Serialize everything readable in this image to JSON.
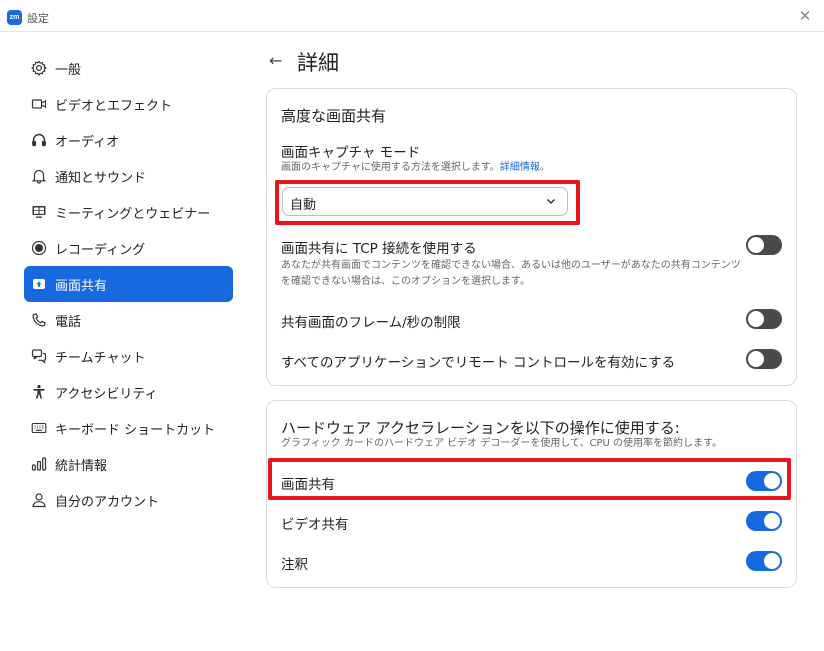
{
  "window": {
    "logo": "zm",
    "title": "設定",
    "close": "✕"
  },
  "sidebar": {
    "items": [
      {
        "label": "一般",
        "icon": "gear-icon"
      },
      {
        "label": "ビデオとエフェクト",
        "icon": "video-camera-icon"
      },
      {
        "label": "オーディオ",
        "icon": "headphones-icon"
      },
      {
        "label": "通知とサウンド",
        "icon": "bell-icon"
      },
      {
        "label": "ミーティングとウェビナー",
        "icon": "meeting-icon"
      },
      {
        "label": "レコーディング",
        "icon": "record-icon"
      },
      {
        "label": "画面共有",
        "icon": "share-screen-icon",
        "active": true
      },
      {
        "label": "電話",
        "icon": "phone-icon"
      },
      {
        "label": "チームチャット",
        "icon": "chat-icon"
      },
      {
        "label": "アクセシビリティ",
        "icon": "accessibility-icon"
      },
      {
        "label": "キーボード ショートカット",
        "icon": "keyboard-icon"
      },
      {
        "label": "統計情報",
        "icon": "stats-icon"
      },
      {
        "label": "自分のアカウント",
        "icon": "user-icon"
      }
    ]
  },
  "header": {
    "back": "←",
    "title": "詳細"
  },
  "advanced_sharing": {
    "title": "高度な画面共有",
    "capture_mode": {
      "label": "画面キャプチャ モード",
      "desc": "画面のキャプチャに使用する方法を選択します。",
      "link": "詳細情報",
      "desc_end": "。",
      "selected": "自動"
    },
    "tcp": {
      "label": "画面共有に TCP 接続を使用する",
      "desc": "あなたが共有画面でコンテンツを確認できない場合、あるいは他のユーザーがあなたの共有コンテンツを確認できない場合は、このオプションを選択します。",
      "on": false
    },
    "fps_limit": {
      "label": "共有画面のフレーム/秒の制限",
      "on": false
    },
    "remote_control": {
      "label": "すべてのアプリケーションでリモート コントロールを有効にする",
      "on": false
    }
  },
  "hardware_accel": {
    "title": "ハードウェア アクセラレーションを以下の操作に使用する:",
    "desc": "グラフィック カードのハードウェア ビデオ デコーダーを使用して、CPU の使用率を節約します。",
    "screen_share": {
      "label": "画面共有",
      "on": true
    },
    "video_share": {
      "label": "ビデオ共有",
      "on": true
    },
    "annotation": {
      "label": "注釈",
      "on": true
    }
  },
  "colors": {
    "accent": "#1769e0",
    "highlight": "#e8141b",
    "toggle_off": "#4a4a4a"
  }
}
